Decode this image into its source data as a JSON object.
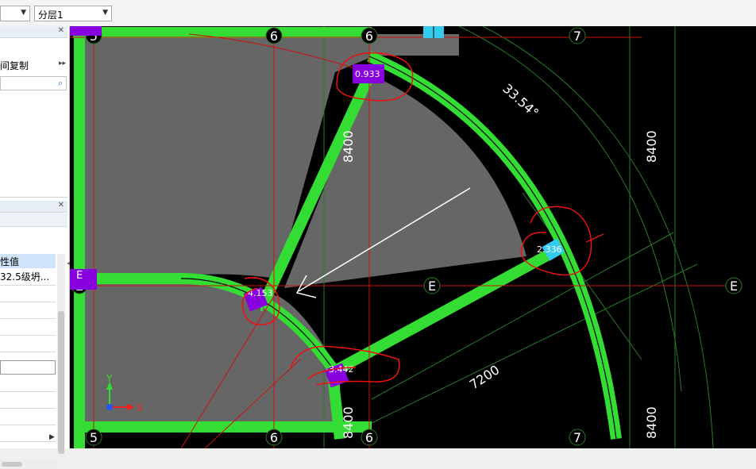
{
  "toolbar": {
    "combo1_value": "",
    "combo2_value": "分层1"
  },
  "left_panel": {
    "copy_label": "间复制",
    "prop_header": "性值",
    "prop_value": "32.5级坍..."
  },
  "drawing": {
    "axis_labels": {
      "top_5": "5",
      "top_6a": "6",
      "top_6b": "6",
      "top_7": "7",
      "bottom_5": "5",
      "bottom_6a": "6",
      "bottom_6b": "6",
      "bottom_7": "7",
      "left_E": "E",
      "mid_E": "E",
      "right_E": "E"
    },
    "dims": {
      "vertical_8400_mid": "8400",
      "vertical_8400_right": "8400",
      "vertical_8400_bottom": "8400",
      "vertical_8400_right_bottom": "8400",
      "diag_7200": "7200",
      "angle": "33.54°"
    },
    "elevations": {
      "top": "0.933",
      "right": "2.336",
      "left": "4.153",
      "bottom": "-3.442"
    },
    "column_label": "E",
    "ucs": {
      "x": "X",
      "y": "Y"
    }
  },
  "colors": {
    "beam_green": "#33dd33",
    "grid_red": "#cc1111",
    "slab_gray": "#666666",
    "column_purple": "#8800dd",
    "column_cyan": "#33ccee"
  }
}
